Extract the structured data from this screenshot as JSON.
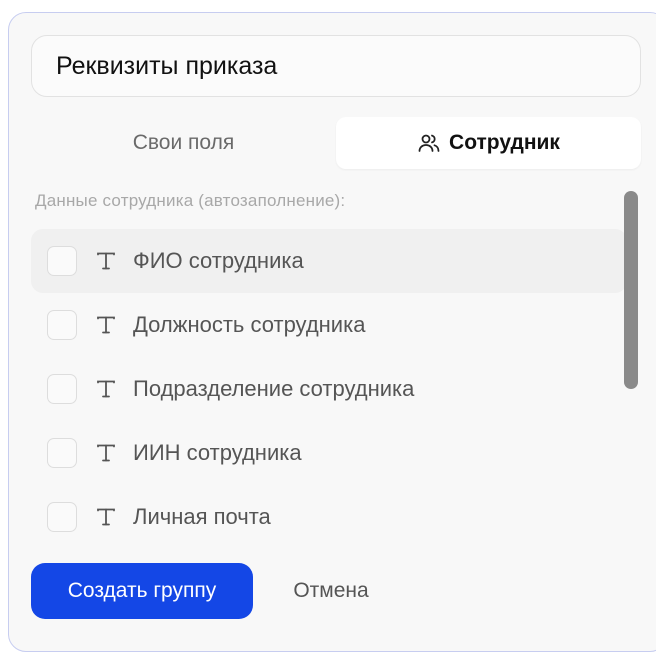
{
  "form": {
    "name_value": "Реквизиты приказа"
  },
  "tabs": [
    {
      "label": "Свои поля",
      "active": false
    },
    {
      "label": "Сотрудник",
      "active": true,
      "icon": "users-icon"
    }
  ],
  "section_label": "Данные сотрудника (автозаполнение):",
  "fields": [
    {
      "label": "ФИО сотрудника",
      "icon": "text-type-icon",
      "checked": false
    },
    {
      "label": "Должность сотрудника",
      "icon": "text-type-icon",
      "checked": false
    },
    {
      "label": "Подразделение сотрудника",
      "icon": "text-type-icon",
      "checked": false
    },
    {
      "label": "ИИН сотрудника",
      "icon": "text-type-icon",
      "checked": false
    },
    {
      "label": "Личная почта",
      "icon": "text-type-icon",
      "checked": false
    }
  ],
  "actions": {
    "create_label": "Создать группу",
    "cancel_label": "Отмена"
  },
  "colors": {
    "accent": "#1447e6",
    "panel_border": "#c7cdf0"
  }
}
